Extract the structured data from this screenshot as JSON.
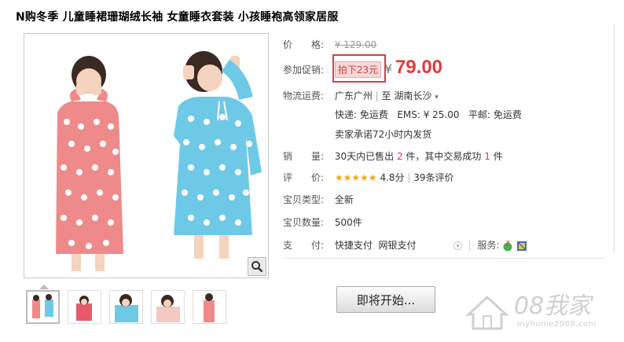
{
  "product": {
    "title": "N购冬季 儿童睡裙珊瑚绒长袖 女童睡衣套装 小孩睡袍高领家居服"
  },
  "price": {
    "label": "价　　格:",
    "original": "¥ 129.00"
  },
  "promo": {
    "label": "参加促销:",
    "tag": "拍下23元",
    "currency": "¥",
    "price": "79.00"
  },
  "shipping": {
    "label": "物流运费:",
    "from": "广东广州",
    "to_prefix": "至",
    "to": "湖南长沙",
    "express": "快递: 免运费",
    "ems": "EMS: ¥ 25.00",
    "normal": "平邮: 免运费",
    "promise": "卖家承诺72小时内发货"
  },
  "sales": {
    "label": "销　　量:",
    "prefix": "30天内已售出",
    "count": "2",
    "mid": "件，其中交易成功",
    "success": "1",
    "suffix": "件"
  },
  "rating": {
    "label": "评　　价:",
    "stars": "★★★★★",
    "score": "4.8分",
    "reviews": "39条评价"
  },
  "type": {
    "label": "宝贝类型:",
    "value": "全新"
  },
  "quantity": {
    "label": "宝贝数量:",
    "value": "500件"
  },
  "payment": {
    "label": "支　　付:",
    "method1": "快捷支付",
    "method2": "网银支付",
    "service_label": "服务:"
  },
  "buy_button": "即将开始...",
  "watermark": {
    "text": "08我家",
    "url": "myhome2008.com"
  },
  "colors": {
    "accent": "#e4393c",
    "pink_robe": "#ef8a8a",
    "blue_robe": "#6ec9e6",
    "star": "#f6a800"
  },
  "icons": {
    "zoom": "magnifier-icon",
    "dropdown": "chevron-down-icon",
    "service1": "seven-day-return-icon",
    "service2": "credit-card-icon"
  }
}
